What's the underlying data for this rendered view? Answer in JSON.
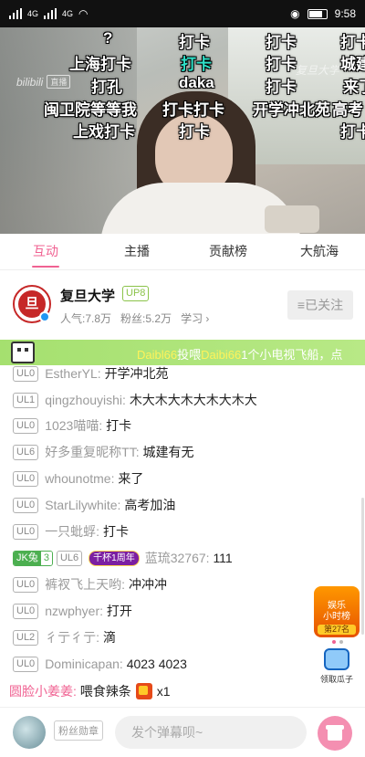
{
  "status_bar": {
    "net_left": "4G",
    "net_right": "4G",
    "time": "9:58"
  },
  "video": {
    "logo_text": "bilibili",
    "logo_badge": "直播",
    "watermark": "复旦大学",
    "danmaku": [
      {
        "text": "?",
        "color": "white"
      },
      {
        "text": "打卡",
        "color": "white"
      },
      {
        "text": "打卡",
        "color": "white"
      },
      {
        "text": "打卡",
        "color": "white"
      },
      {
        "text": "上海打卡",
        "color": "white"
      },
      {
        "text": "打卡",
        "color": "teal"
      },
      {
        "text": "打卡",
        "color": "white"
      },
      {
        "text": "城建",
        "color": "white"
      },
      {
        "text": "打孔",
        "color": "white"
      },
      {
        "text": "daka",
        "color": "white"
      },
      {
        "text": "打卡",
        "color": "white"
      },
      {
        "text": "来了",
        "color": "white"
      },
      {
        "text": "闽卫院等等我",
        "color": "white"
      },
      {
        "text": "打卡打卡",
        "color": "white"
      },
      {
        "text": "开学冲北苑",
        "color": "white"
      },
      {
        "text": "高考",
        "color": "white"
      },
      {
        "text": "上戏打卡",
        "color": "white"
      },
      {
        "text": "打卡",
        "color": "white"
      },
      {
        "text": "打卡",
        "color": "white"
      }
    ]
  },
  "tabs": [
    {
      "label": "互动",
      "active": true
    },
    {
      "label": "主播",
      "active": false
    },
    {
      "label": "贡献榜",
      "active": false
    },
    {
      "label": "大航海",
      "active": false
    }
  ],
  "streamer": {
    "avatar_text": "旦",
    "name": "复旦大学",
    "level": "UP8",
    "popularity": "人气:7.8万",
    "fans": "粉丝:5.2万",
    "category": "学习 ›",
    "follow_label": "≡已关注"
  },
  "banner": {
    "sender": "Daibl66",
    "verb": "投喂",
    "receiver": "Daibi66",
    "gift": "1个小电视飞船，点"
  },
  "comments": [
    {
      "level": "UL0",
      "user": "EstherYL:",
      "text": "开学冲北苑"
    },
    {
      "level": "UL1",
      "user": "qingzhouyishi:",
      "text": "木大木大木大木大木大"
    },
    {
      "level": "UL0",
      "user": "1023喵喵:",
      "text": "打卡"
    },
    {
      "level": "UL6",
      "user": "好多重复昵称TT:",
      "text": "城建有无"
    },
    {
      "level": "UL0",
      "user": "whounotme:",
      "text": "来了"
    },
    {
      "level": "UL0",
      "user": "StarLilywhite:",
      "text": "高考加油"
    },
    {
      "level": "UL0",
      "user": "一只蚍蜉:",
      "text": "打卡"
    },
    {
      "level": "UL6",
      "user": "蓝琉32767:",
      "text": "111",
      "medal_name": "JK兔",
      "medal_level": "3",
      "cap": "千杯1周年"
    },
    {
      "level": "UL0",
      "user": "裤衩飞上天哟:",
      "text": "冲冲冲"
    },
    {
      "level": "UL0",
      "user": "nzwphyer:",
      "text": "打开"
    },
    {
      "level": "UL2",
      "user": "彳亍彳亍:",
      "text": "滴"
    },
    {
      "level": "UL0",
      "user": "Dominicapan:",
      "text": "4023 4023"
    }
  ],
  "gift_message": {
    "user": "圆脸小姜姜:",
    "text": "喂食辣条",
    "count": "x1"
  },
  "rank_widget": {
    "line1": "娱乐",
    "line2": "小时榜",
    "rank": "第27名"
  },
  "melon_widget": {
    "label": "领取瓜子"
  },
  "bottom_bar": {
    "fans_medal": "粉丝勋章",
    "input_placeholder": "发个弹幕呗~"
  },
  "colors": {
    "accent": "#f06292",
    "banner_green": "#a5e06f",
    "up_level": "#8bc34a"
  }
}
